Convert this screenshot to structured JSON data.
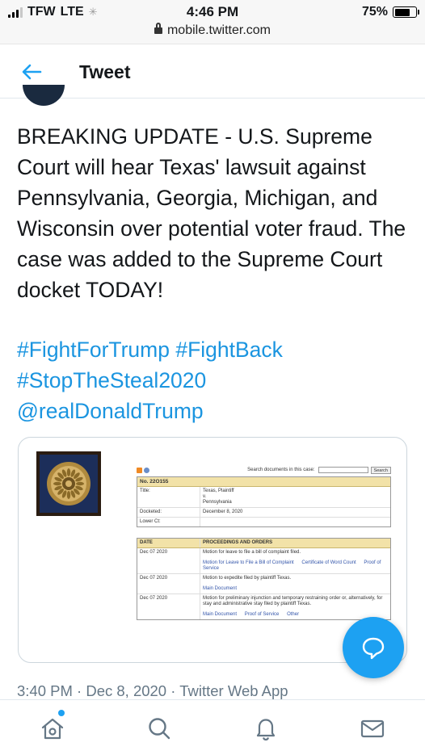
{
  "status_bar": {
    "carrier": "TFW",
    "network": "LTE",
    "time": "4:46 PM",
    "url": "mobile.twitter.com",
    "battery": "75%",
    "battery_level": 0.75
  },
  "header": {
    "back_icon": "arrow-left-icon",
    "title": "Tweet"
  },
  "tweet": {
    "text": "BREAKING UPDATE - U.S. Supreme Court will hear Texas' lawsuit against Pennsylvania, Georgia, Michigan, and Wisconsin over potential voter fraud. The case was added to the Supreme Court docket TODAY!",
    "hashtags_line1": "#FightForTrump #FightBack",
    "hashtags_line2": "#StopTheSteal2020",
    "mention": "@realDonaldTrump",
    "timestamp": "3:40 PM · Dec 8, 2020 · Twitter Web App"
  },
  "embedded_image": {
    "search_label": "Search documents in this case:",
    "search_button": "Search",
    "case_number": "No. 22O155",
    "rows": [
      {
        "key": "Title:",
        "value": "Texas, Plaintiff\nv.\nPennsylvania"
      },
      {
        "key": "Docketed:",
        "value": "December 8, 2020"
      },
      {
        "key": "Lower Ct:",
        "value": ""
      }
    ],
    "proceedings_header_date": "DATE",
    "proceedings_header_title": "PROCEEDINGS AND ORDERS",
    "proceedings": [
      {
        "date": "Dec 07 2020",
        "text": "Motion for leave to file a bill of complaint filed.",
        "links": [
          "Motion for Leave to File a Bill of Complaint",
          "Certificate of Word Count",
          "Proof of Service"
        ]
      },
      {
        "date": "Dec 07 2020",
        "text": "Motion to expedite filed by plaintiff Texas.",
        "links": [
          "Main Document"
        ]
      },
      {
        "date": "Dec 07 2020",
        "text": "Motion for preliminary injunction and temporary restraining order or, alternatively, for stay and administrative stay filed by plaintiff Texas.",
        "links": [
          "Main Document",
          "Proof of Service",
          "Other"
        ]
      }
    ]
  },
  "bottom_nav": [
    "home-icon",
    "search-icon",
    "bell-icon",
    "mail-icon"
  ],
  "colors": {
    "accent": "#1da1f2",
    "link": "#1b95e0",
    "text": "#14171a",
    "meta": "#657786"
  }
}
